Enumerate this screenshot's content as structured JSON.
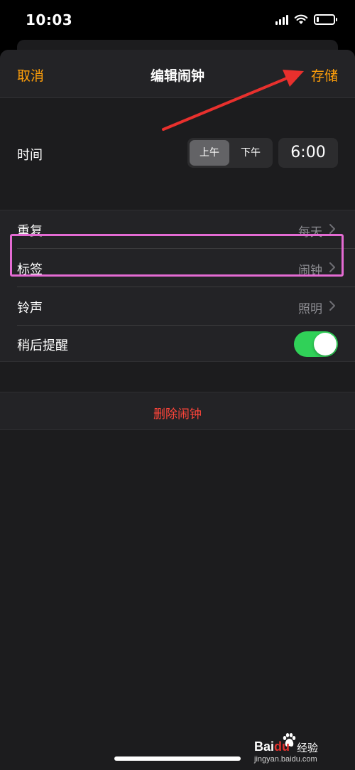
{
  "status_bar": {
    "time": "10:03",
    "battery_level": 0.12
  },
  "nav": {
    "cancel_label": "取消",
    "title": "编辑闹钟",
    "save_label": "存储"
  },
  "time": {
    "label": "时间",
    "am_label": "上午",
    "pm_label": "下午",
    "selected_period": "上午",
    "value": "6:00"
  },
  "settings": [
    {
      "label": "重复",
      "value": "每天"
    },
    {
      "label": "标签",
      "value": "闹钟"
    },
    {
      "label": "铃声",
      "value": "照明"
    }
  ],
  "snooze": {
    "label": "稍后提醒",
    "enabled": true
  },
  "delete_label": "删除闹钟",
  "annotation": {
    "arrow_color": "#e8302d",
    "highlight_color": "#e46bd3"
  },
  "watermark": {
    "brand_left": "Bai",
    "brand_right": "du",
    "cn": "经验",
    "url": "jingyan.baidu.com"
  },
  "colors": {
    "accent": "#ff9f0a",
    "destructive": "#ff453a",
    "toggle_on": "#30d158"
  }
}
